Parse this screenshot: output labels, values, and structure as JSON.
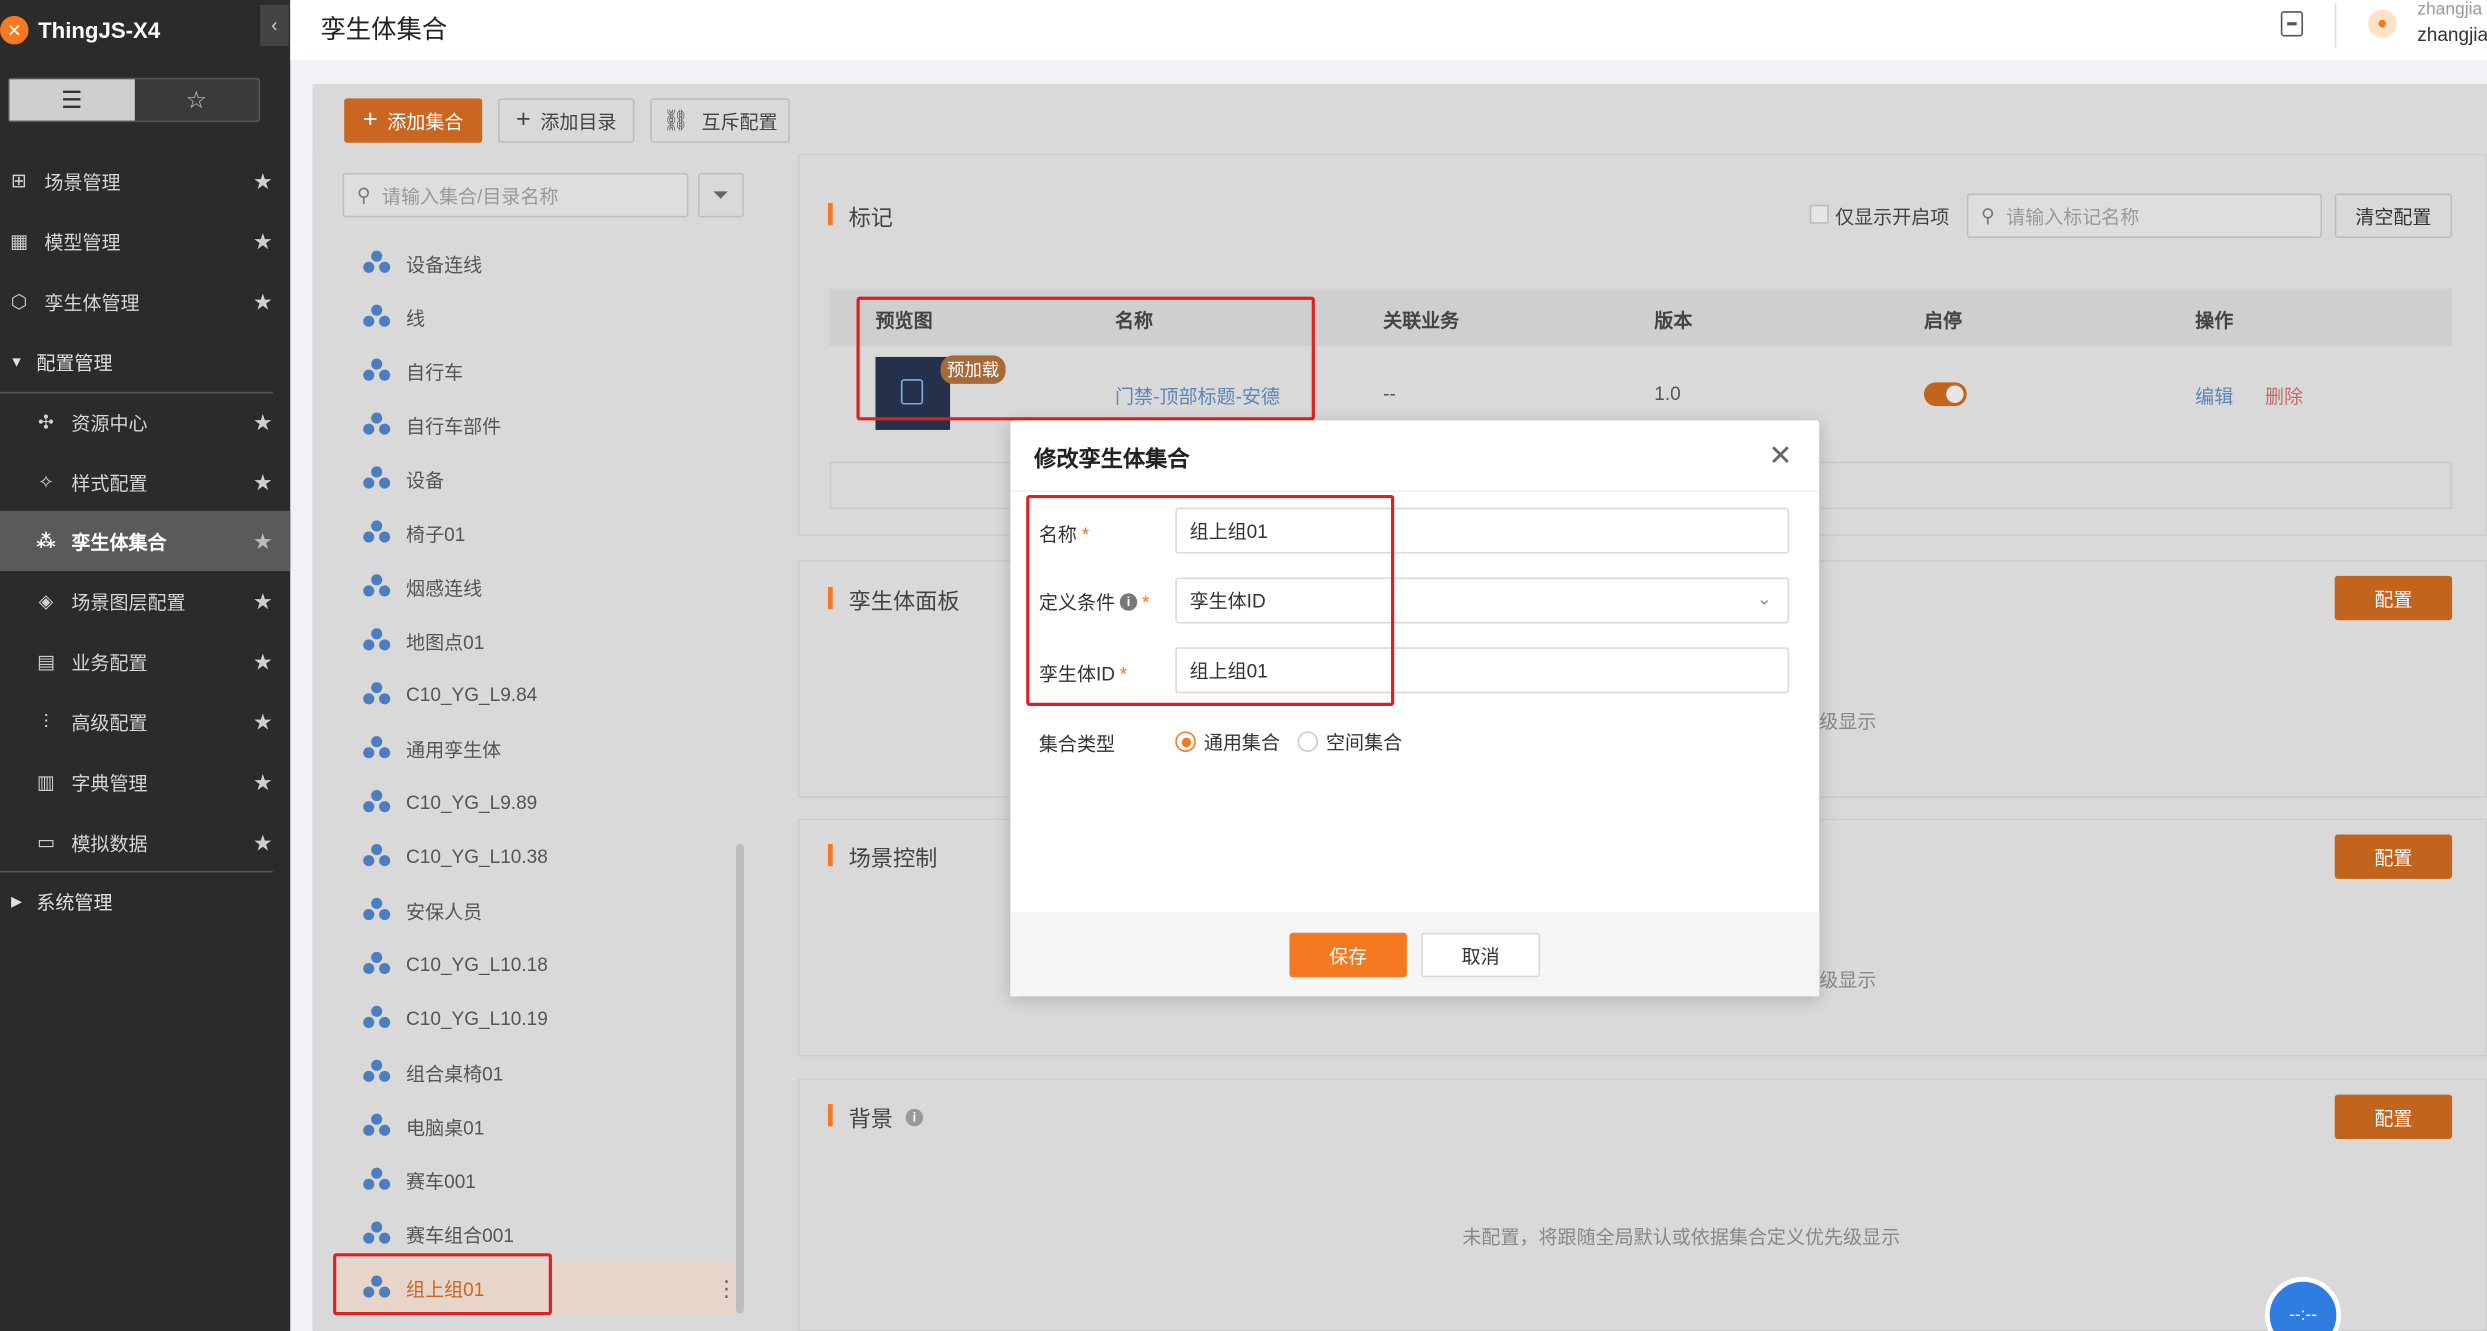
{
  "app": {
    "logo_text": "ThingJS-X4",
    "logo_mark": "✕"
  },
  "header": {
    "title": "孪生体集合",
    "user_line1": "zhangjia",
    "user_line2": "zhangjia"
  },
  "sidebar": {
    "items": [
      {
        "label": "场景管理",
        "icon": "grid-icon"
      },
      {
        "label": "模型管理",
        "icon": "table-icon"
      },
      {
        "label": "孪生体管理",
        "icon": "cube-icon"
      },
      {
        "label": "配置管理",
        "icon": "caret-down-icon"
      },
      {
        "label": "资源中心",
        "icon": "puzzle-icon"
      },
      {
        "label": "样式配置",
        "icon": "paint-icon"
      },
      {
        "label": "孪生体集合",
        "icon": "cluster-icon"
      },
      {
        "label": "场景图层配置",
        "icon": "layers-icon"
      },
      {
        "label": "业务配置",
        "icon": "book-icon"
      },
      {
        "label": "高级配置",
        "icon": "sliders-icon"
      },
      {
        "label": "字典管理",
        "icon": "list-icon"
      },
      {
        "label": "模拟数据",
        "icon": "monitor-icon"
      },
      {
        "label": "系统管理",
        "icon": "caret-right-icon"
      }
    ]
  },
  "toolbar": {
    "add_collection": "添加集合",
    "add_dir": "添加目录",
    "mutex": "互斥配置"
  },
  "tree": {
    "search_placeholder": "请输入集合/目录名称",
    "items": [
      "设备连线",
      "线",
      "自行车",
      "自行车部件",
      "设备",
      "椅子01",
      "烟感连线",
      "地图点01",
      "C10_YG_L9.84",
      "通用孪生体",
      "C10_YG_L9.89",
      "C10_YG_L10.38",
      "安保人员",
      "C10_YG_L10.18",
      "C10_YG_L10.19",
      "组合桌椅01",
      "电脑桌01",
      "赛车001",
      "赛车组合001",
      "组上组01"
    ]
  },
  "marker": {
    "title": "标记",
    "only_enabled": "仅显示开启项",
    "search_placeholder": "请输入标记名称",
    "clear": "清空配置",
    "columns": [
      "预览图",
      "名称",
      "关联业务",
      "版本",
      "启停",
      "操作"
    ],
    "row": {
      "badge": "预加载",
      "name": "门禁-顶部标题-安德",
      "biz": "--",
      "version": "1.0",
      "edit": "编辑",
      "delete": "删除"
    }
  },
  "panels": [
    {
      "title": "孪生体面板",
      "btn": "配置",
      "text": "级显示"
    },
    {
      "title": "场景控制",
      "btn": "配置",
      "text": "级显示"
    },
    {
      "title": "背景",
      "btn": "配置",
      "text": "未配置，将跟随全局默认或依据集合定义优先级显示"
    }
  ],
  "modal": {
    "title": "修改孪生体集合",
    "name_label": "名称",
    "name_value": "组上组01",
    "cond_label": "定义条件",
    "cond_value": "孪生体ID",
    "id_label": "孪生体ID",
    "id_value": "组上组01",
    "type_label": "集合类型",
    "type_general": "通用集合",
    "type_space": "空间集合",
    "save": "保存",
    "cancel": "取消"
  },
  "float": {
    "text": "--:--"
  },
  "colors": {
    "accent": "#f47920",
    "sidebar": "#2b2b2b",
    "danger_box": "#e02020"
  }
}
